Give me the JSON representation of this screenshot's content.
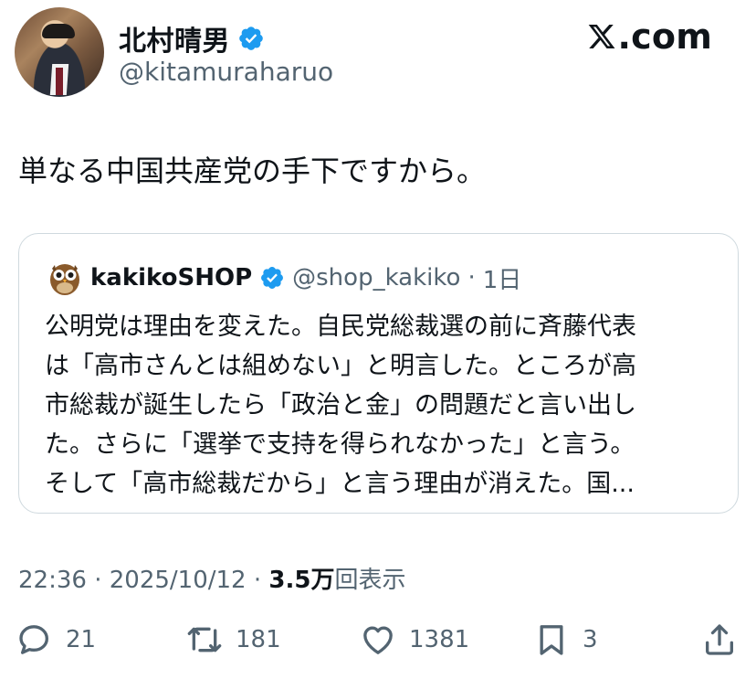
{
  "author": {
    "name": "北村晴男",
    "handle": "@kitamuraharuo",
    "avatar_icon": "profile-photo",
    "verified_icon": "verified-badge-icon"
  },
  "brand": {
    "text": ".com",
    "icon": "x-logo-icon"
  },
  "tweet": {
    "text": "単なる中国共産党の手下ですから。"
  },
  "quote": {
    "name": "kakikoSHOP",
    "handle": "@shop_kakiko",
    "separator": "·",
    "age": "1日",
    "avatar_icon": "owl-avatar-icon",
    "lines": [
      "公明党は理由を変えた。自民党総裁選の前に斉藤代表",
      "は「高市さんとは組めない」と明言した。ところが高",
      "市総裁が誕生したら「政治と金」の問題だと言い出し",
      "た。さらに「選挙で支持を得られなかった」と言う。",
      "そして「高市総裁だから」と言う理由が消えた。国..."
    ]
  },
  "timestamp": {
    "time": "22:36",
    "sep1": "·",
    "date": "2025/10/12",
    "sep2": "·",
    "views": "3.5万",
    "views_suffix": "回表示"
  },
  "actions": {
    "reply": {
      "icon": "reply-icon",
      "count": "21"
    },
    "repost": {
      "icon": "repost-icon",
      "count": "181"
    },
    "like": {
      "icon": "heart-icon",
      "count": "1381"
    },
    "bookmark": {
      "icon": "bookmark-icon",
      "count": "3"
    },
    "share": {
      "icon": "share-icon"
    }
  },
  "colors": {
    "text": "#0f1419",
    "muted": "#536471",
    "verified": "#1d9bf0",
    "border": "#cfd9de"
  }
}
